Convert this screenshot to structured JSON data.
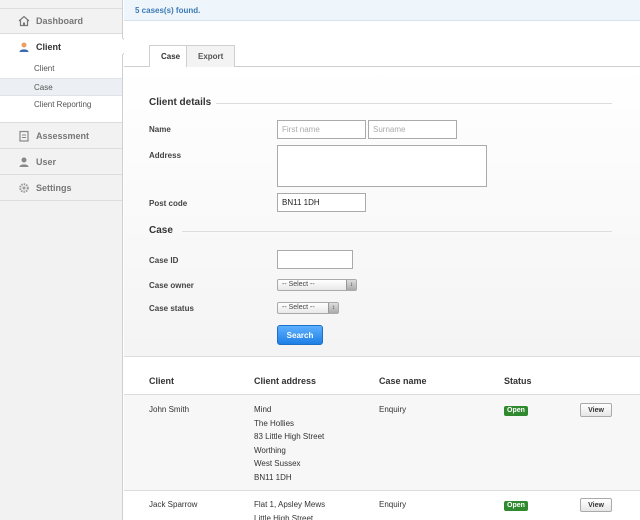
{
  "sidebar": {
    "dashboard": "Dashboard",
    "client": "Client",
    "client_sub": [
      "Client",
      "Case",
      "Client Reporting"
    ],
    "assessment": "Assessment",
    "user": "User",
    "settings": "Settings"
  },
  "notice": "5 cases(s) found.",
  "tabs": {
    "case": "Case",
    "export": "Export"
  },
  "form": {
    "client_details_title": "Client details",
    "name_label": "Name",
    "first_name_placeholder": "First name",
    "surname_placeholder": "Surname",
    "address_label": "Address",
    "postcode_label": "Post code",
    "postcode_value": "BN11 1DH",
    "case_title": "Case",
    "case_id_label": "Case ID",
    "case_owner_label": "Case owner",
    "case_owner_value": "-- Select --",
    "case_status_label": "Case status",
    "case_status_value": "-- Select --",
    "search_label": "Search"
  },
  "table": {
    "headers": [
      "Client",
      "Client address",
      "Case name",
      "Status"
    ],
    "rows": [
      {
        "client": "John Smith",
        "address": [
          "Mind",
          "The Hollies",
          "83 Little High Street",
          "Worthing",
          "West Sussex",
          "BN11 1DH"
        ],
        "case_name": "Enquiry",
        "status": "Open",
        "action": "View"
      },
      {
        "client": "Jack Sparrow",
        "address": [
          "Flat 1, Apsley Mews",
          "Little High Street"
        ],
        "case_name": "Enquiry",
        "status": "Open",
        "action": "View"
      }
    ]
  },
  "colors": {
    "accent": "#1f7fe6",
    "status_open": "#2f8a2f",
    "notice_text": "#3d7ab5"
  }
}
